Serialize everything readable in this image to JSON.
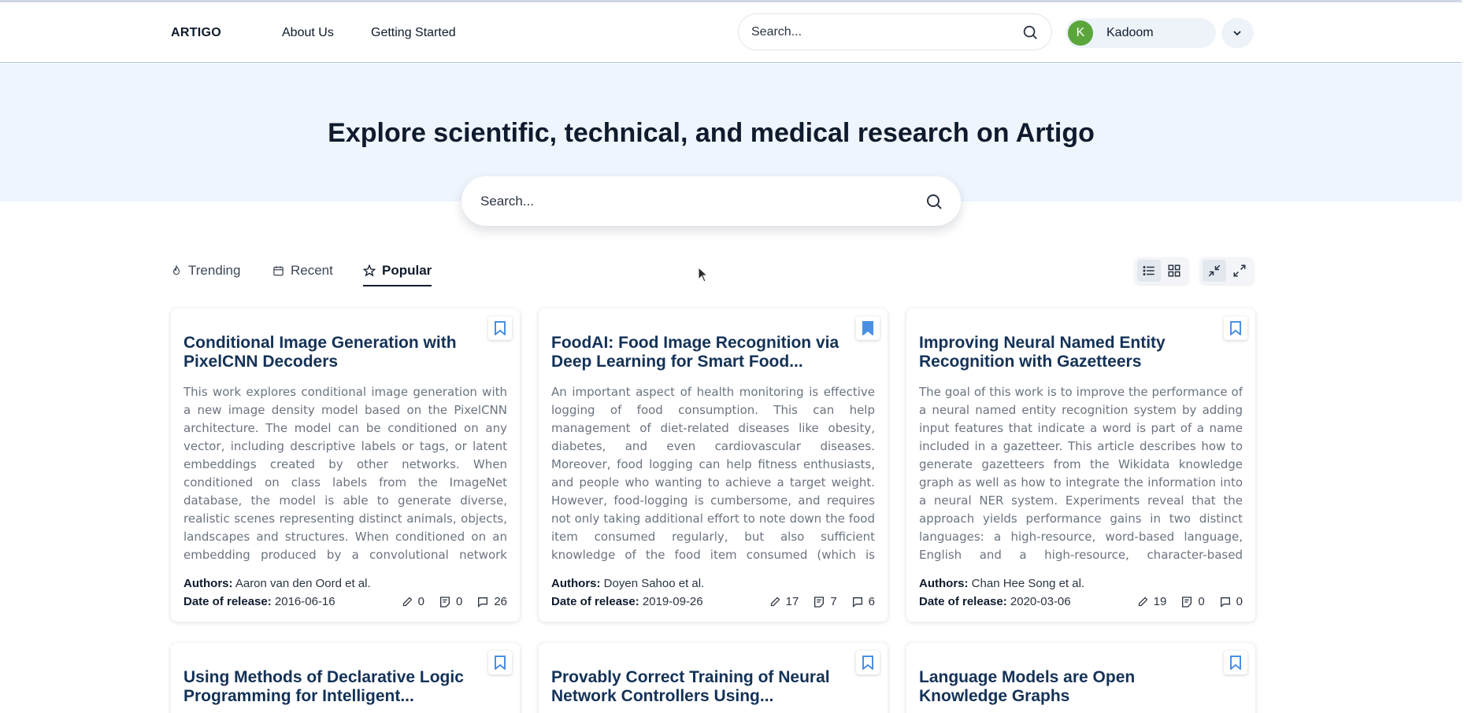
{
  "header": {
    "logo": "ARTIGO",
    "nav": [
      "About Us",
      "Getting Started"
    ],
    "search_placeholder": "Search...",
    "user": {
      "initial": "K",
      "name": "Kadoom"
    }
  },
  "hero": {
    "title": "Explore scientific, technical, and medical research on Artigo",
    "search_placeholder": "Search..."
  },
  "tabs": [
    {
      "label": "Trending",
      "icon": "flame-icon"
    },
    {
      "label": "Recent",
      "icon": "calendar-icon"
    },
    {
      "label": "Popular",
      "icon": "star-icon",
      "active": true
    }
  ],
  "view_toggles": [
    "list-view-icon",
    "grid-view-icon",
    "collapse-icon",
    "expand-icon"
  ],
  "labels": {
    "authors": "Authors:",
    "date": "Date of release:"
  },
  "cards": [
    {
      "title": "Conditional Image Generation with PixelCNN Decoders",
      "abstract": "This work explores conditional image generation with a new image density model based on the PixelCNN architecture. The model can be conditioned on any vector, including descriptive labels or tags, or latent embeddings created by other networks. When conditioned on class labels from the ImageNet database, the model is able to generate diverse, realistic scenes representing distinct animals, objects, landscapes and structures. When conditioned on an embedding produced by a convolutional network given a single image of an unsee",
      "authors": "Aaron van den Oord et al.",
      "date": "2016-06-16",
      "edits": "0",
      "notes": "0",
      "comments": "26",
      "bookmarked": false
    },
    {
      "title": "FoodAI: Food Image Recognition via Deep Learning for Smart Food...",
      "abstract": "An important aspect of health monitoring is effective logging of food consumption. This can help management of diet-related diseases like obesity, diabetes, and even cardiovascular diseases. Moreover, food logging can help fitness enthusiasts, and people who wanting to achieve a target weight. However, food-logging is cumbersome, and requires not only taking additional effort to note down the food item consumed regularly, but also sufficient knowledge of the food item consumed (which is difficult due to the availability of a wide variety of cuisines). Wit",
      "authors": "Doyen Sahoo et al.",
      "date": "2019-09-26",
      "edits": "17",
      "notes": "7",
      "comments": "6",
      "bookmarked": true
    },
    {
      "title": "Improving Neural Named Entity Recognition with Gazetteers",
      "abstract": "The goal of this work is to improve the performance of a neural named entity recognition system by adding input features that indicate a word is part of a name included in a gazetteer. This article describes how to generate gazetteers from the Wikidata knowledge graph as well as how to integrate the information into a neural NER system. Experiments reveal that the approach yields performance gains in two distinct languages: a high-resource, word-based language, English and a high-resource, character-based language, Chinese. Experiments were als",
      "authors": "Chan Hee Song et al.",
      "date": "2020-03-06",
      "edits": "19",
      "notes": "0",
      "comments": "0",
      "bookmarked": false
    },
    {
      "title": "Using Methods of Declarative Logic Programming for Intelligent...",
      "bookmarked": false
    },
    {
      "title": "Provably Correct Training of Neural Network Controllers Using...",
      "bookmarked": false
    },
    {
      "title": "Language Models are Open Knowledge Graphs",
      "bookmarked": false
    }
  ],
  "colors": {
    "accent": "#143257",
    "bookmark": "#4a90e2",
    "hero_bg": "#eef5fc",
    "avatar": "#5aa63b"
  }
}
